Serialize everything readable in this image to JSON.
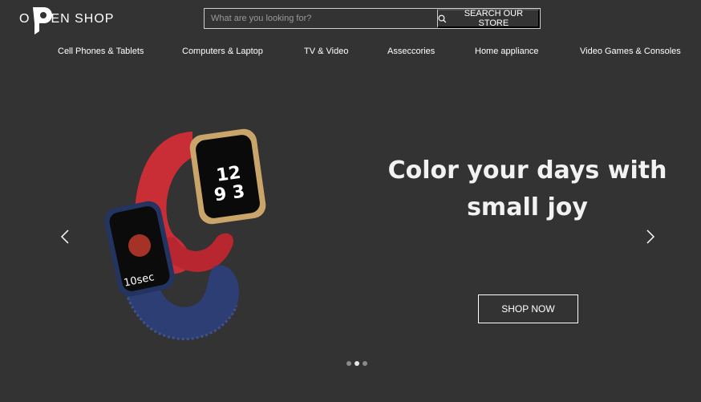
{
  "header": {
    "logo_o": "O",
    "logo_text": "EN SHOP",
    "search_placeholder": "What are you looking for?",
    "search_button_label": "SEARCH OUR STORE"
  },
  "nav": {
    "items": [
      "Cell Phones & Tablets",
      "Computers & Laptop",
      "TV & Video",
      "Asseccories",
      "Home appliance",
      "Video Games & Consoles"
    ]
  },
  "hero": {
    "headline_line1": "Color your days with",
    "headline_line2": "small joy",
    "cta_label": "SHOP NOW",
    "watch_time_text": "10sec",
    "image_description": "two smartwatches, red band and blue braided band"
  },
  "carousel": {
    "slide_count": 3,
    "active_index": 1
  },
  "colors": {
    "background": "#333333",
    "text": "#ffffff",
    "watch_red": "#c92e37",
    "watch_blue": "#2c3e73"
  }
}
